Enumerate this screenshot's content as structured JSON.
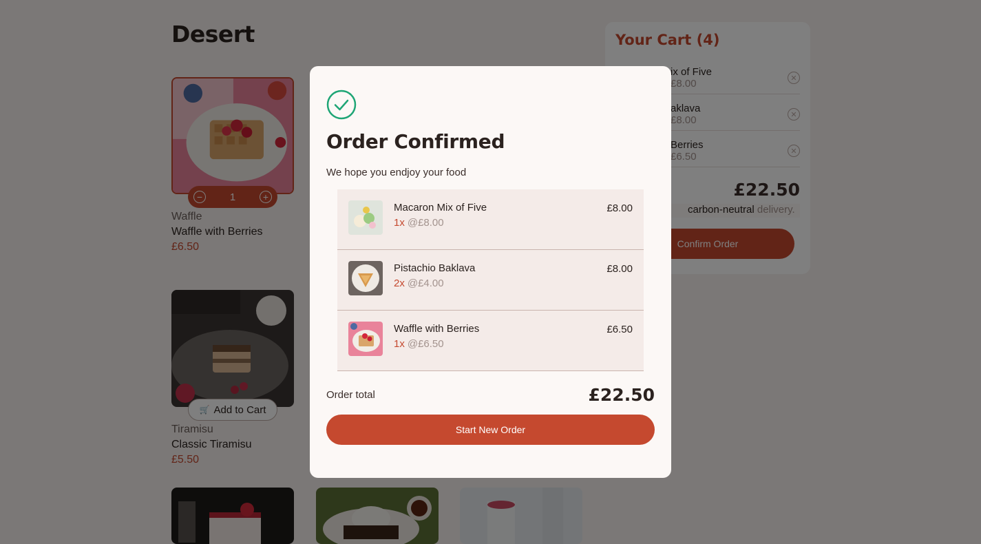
{
  "page": {
    "heading": "Desert"
  },
  "products": [
    {
      "category": "Waffle",
      "name": "Waffle with Berries",
      "price": "£6.50",
      "quantity": "1",
      "decrement_icon": "minus-circle-icon",
      "increment_icon": "plus-circle-icon"
    },
    {
      "category": "Tiramisu",
      "name": "Classic Tiramisu",
      "price": "£5.50",
      "add_label": "Add to Cart",
      "cart_icon": "add-to-cart-icon"
    }
  ],
  "cart": {
    "title": "Your Cart (4)",
    "items": [
      {
        "name": "ix of Five",
        "sub": "£8.00",
        "remove_icon": "remove-item-icon"
      },
      {
        "name": "aklava",
        "sub": "£8.00",
        "remove_icon": "remove-item-icon"
      },
      {
        "name": "Berries",
        "sub": "£6.50",
        "remove_icon": "remove-item-icon"
      }
    ],
    "total": "£22.50",
    "carbon_text": "carbon-neutral",
    "carbon_suffix": "delivery.",
    "confirm_label": "Confirm Order"
  },
  "modal": {
    "icon": "check-circle-icon",
    "title": "Order Confirmed",
    "subtitle": "We hope you endjoy your food",
    "items": [
      {
        "name": "Macaron Mix of Five",
        "qty": "1x",
        "unit": "@£8.00",
        "price": "£8.00"
      },
      {
        "name": "Pistachio Baklava",
        "qty": "2x",
        "unit": "@£4.00",
        "price": "£8.00"
      },
      {
        "name": "Waffle with Berries",
        "qty": "1x",
        "unit": "@£6.50",
        "price": "£6.50"
      }
    ],
    "total_label": "Order total",
    "total_value": "£22.50",
    "button_label": "Start New Order"
  },
  "colors": {
    "accent": "#c5492f",
    "background": "#f7f1ee",
    "success": "#1ea575",
    "text": "#2b221f"
  }
}
